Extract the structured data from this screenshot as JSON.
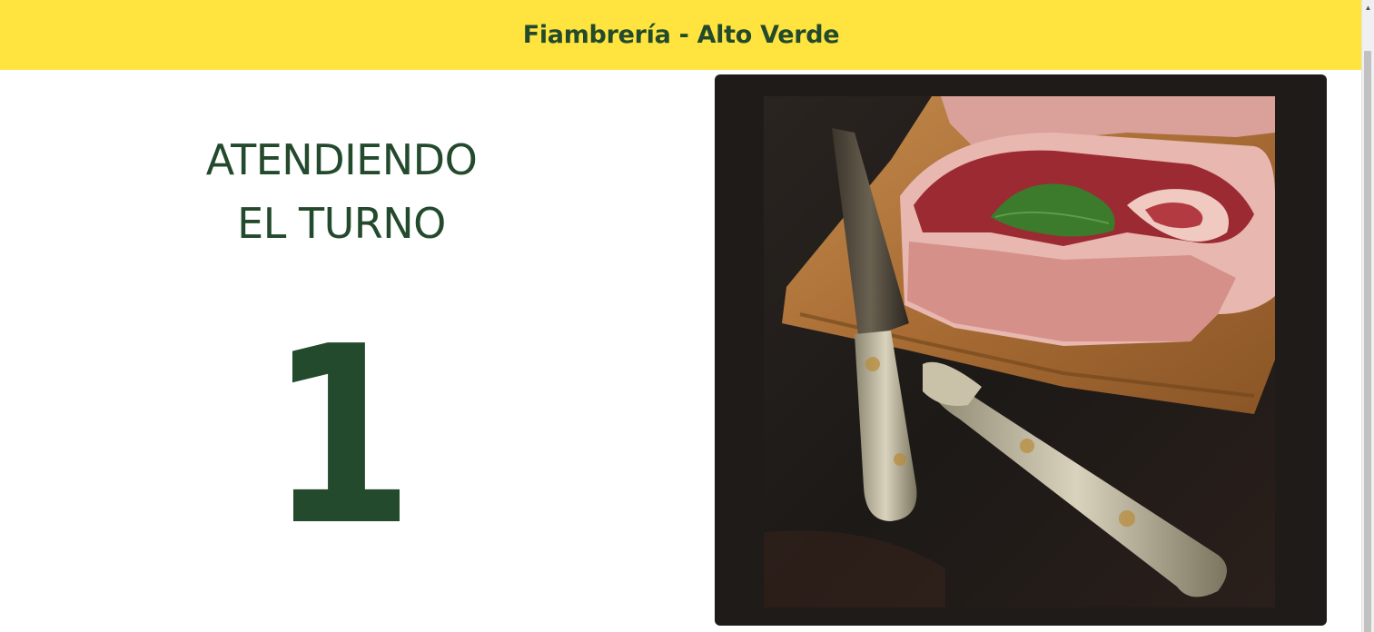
{
  "header": {
    "title": "Fiambrería - Alto Verde"
  },
  "turn": {
    "label_line1": "ATENDIENDO",
    "label_line2": "EL TURNO",
    "number": "1"
  },
  "colors": {
    "header_bg": "#ffe43f",
    "brand_green": "#234a2c",
    "photo_frame": "#1f1b19"
  },
  "photo": {
    "subject": "raw-meat-with-gaucho-knives-photo"
  },
  "scrollbar": {
    "up_arrow_icon": "triangle-up-icon"
  }
}
